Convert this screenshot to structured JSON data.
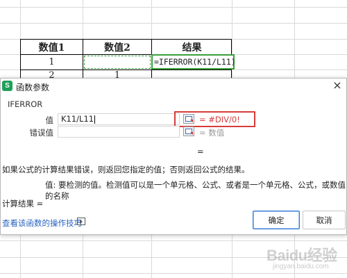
{
  "sheet": {
    "headers": [
      "数值1",
      "数值2",
      "结果"
    ],
    "row1": [
      "1",
      "",
      "=IFERROR(K11/L11)"
    ],
    "row2": [
      "2",
      "1",
      ""
    ]
  },
  "dialog": {
    "title": "函数参数",
    "logo_letter": "S",
    "close_symbol": "×",
    "function_name": "IFERROR",
    "value_label": "值",
    "value_input": "K11/L11",
    "value_result": "= #DIV/0!",
    "error_label": "错误值",
    "error_input": "",
    "error_result": "= 数值",
    "mid_equals": "=",
    "description": "如果公式的计算结果错误，则返回您指定的值；否则返回公式的结果。",
    "param_desc": "值:  要检测的值。检测值可以是一个单元格、公式、或者是一个单元格、公式，或数值的名称",
    "calc_result": "计算结果 =",
    "help_link": "查看该函数的操作技巧",
    "ok_label": "确定",
    "cancel_label": "取消",
    "highlight_color": "#d83b3b",
    "accent_color": "#3a78d8"
  },
  "watermark": {
    "main": "Baidu经验",
    "sub": "jingyan.baidu.com"
  }
}
